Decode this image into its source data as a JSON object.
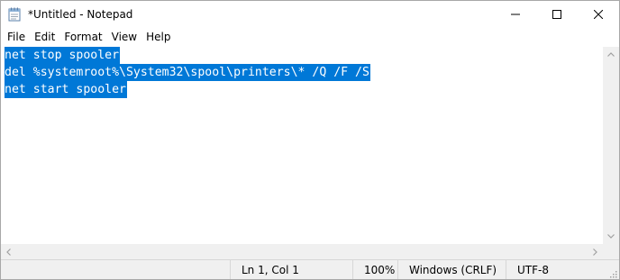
{
  "window": {
    "title": "*Untitled - Notepad",
    "app_icon": "notepad-icon",
    "controls": [
      "minimize-icon",
      "maximize-icon",
      "close-icon"
    ]
  },
  "menu": {
    "items": [
      {
        "label": "File"
      },
      {
        "label": "Edit"
      },
      {
        "label": "Format"
      },
      {
        "label": "View"
      },
      {
        "label": "Help"
      }
    ]
  },
  "editor": {
    "lines": [
      "net stop spooler",
      "del %systemroot%\\System32\\spool\\printers\\* /Q /F /S",
      "net start spooler"
    ],
    "selection": "all",
    "selection_color": "#0078d7"
  },
  "statusbar": {
    "position": "Ln 1, Col 1",
    "zoom": "100%",
    "line_ending": "Windows (CRLF)",
    "encoding": "UTF-8"
  }
}
